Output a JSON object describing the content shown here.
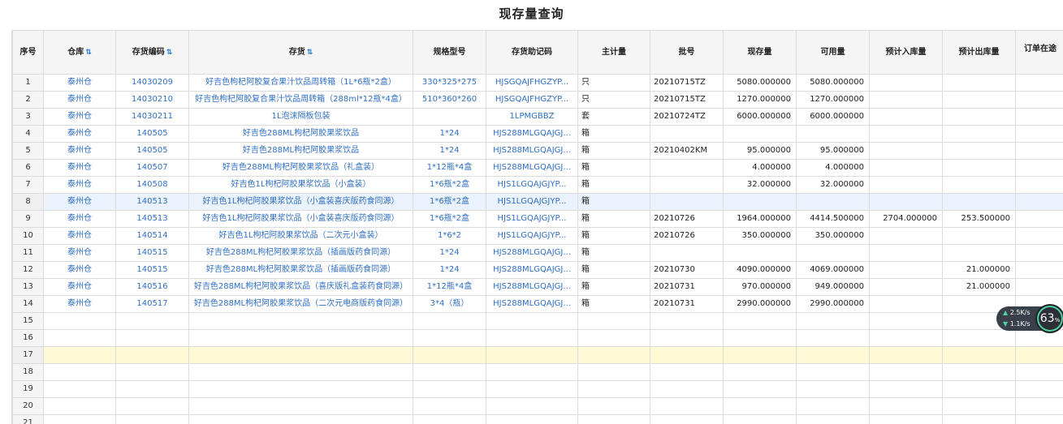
{
  "title": "现存量查询",
  "columns": [
    {
      "label": "序号",
      "sort": false
    },
    {
      "label": "仓库",
      "sort": true
    },
    {
      "label": "存货编码",
      "sort": true
    },
    {
      "label": "存货",
      "sort": true
    },
    {
      "label": "规格型号",
      "sort": false
    },
    {
      "label": "存货助记码",
      "sort": false
    },
    {
      "label": "主计量",
      "sort": false
    },
    {
      "label": "批号",
      "sort": false
    },
    {
      "label": "现存量",
      "sort": false
    },
    {
      "label": "可用量",
      "sort": false
    },
    {
      "label": "预计入库量",
      "sort": false
    },
    {
      "label": "预计出库量",
      "sort": false
    },
    {
      "label": "订单在途",
      "sort": false
    }
  ],
  "rows": [
    {
      "seq": "1",
      "warehouse": "泰州仓",
      "code": "14030209",
      "item": "好吉色枸杞阿胶复合果汁饮品周转箱（1L*6瓶*2盒）",
      "spec": "330*325*275",
      "mnemonic": "HJSGQAJFHGZYP...",
      "uom": "只",
      "batch": "20210715TZ",
      "onhand": "5080.000000",
      "available": "5080.000000",
      "exp_in": "",
      "exp_out": "",
      "onorder": ""
    },
    {
      "seq": "2",
      "warehouse": "泰州仓",
      "code": "14030210",
      "item": "好吉色枸杞阿胶复合果汁饮品周转箱（288ml*12瓶*4盒）",
      "spec": "510*360*260",
      "mnemonic": "HJSGQAJFHGZYP...",
      "uom": "只",
      "batch": "20210715TZ",
      "onhand": "1270.000000",
      "available": "1270.000000",
      "exp_in": "",
      "exp_out": "",
      "onorder": ""
    },
    {
      "seq": "3",
      "warehouse": "泰州仓",
      "code": "14030211",
      "item": "1L泡沫隔板包装",
      "spec": "",
      "mnemonic": "1LPMGBBZ",
      "uom": "套",
      "batch": "20210724TZ",
      "onhand": "6000.000000",
      "available": "6000.000000",
      "exp_in": "",
      "exp_out": "",
      "onorder": ""
    },
    {
      "seq": "4",
      "warehouse": "泰州仓",
      "code": "140505",
      "item": "好吉色288ML枸杞阿胶果浆饮品",
      "spec": "1*24",
      "mnemonic": "HJS288MLGQAJGJ...",
      "uom": "箱",
      "batch": "",
      "onhand": "",
      "available": "",
      "exp_in": "",
      "exp_out": "",
      "onorder": ""
    },
    {
      "seq": "5",
      "warehouse": "泰州仓",
      "code": "140505",
      "item": "好吉色288ML枸杞阿胶果浆饮品",
      "spec": "1*24",
      "mnemonic": "HJS288MLGQAJGJ...",
      "uom": "箱",
      "batch": "20210402KM",
      "onhand": "95.000000",
      "available": "95.000000",
      "exp_in": "",
      "exp_out": "",
      "onorder": ""
    },
    {
      "seq": "6",
      "warehouse": "泰州仓",
      "code": "140507",
      "item": "好吉色288ML枸杞阿胶果浆饮品（礼盒装）",
      "spec": "1*12瓶*4盒",
      "mnemonic": "HJS288MLGQAJGJ...",
      "uom": "箱",
      "batch": "",
      "onhand": "4.000000",
      "available": "4.000000",
      "exp_in": "",
      "exp_out": "",
      "onorder": ""
    },
    {
      "seq": "7",
      "warehouse": "泰州仓",
      "code": "140508",
      "item": "好吉色1L枸杞阿胶果浆饮品（小盒装）",
      "spec": "1*6瓶*2盒",
      "mnemonic": "HJS1LGQAJGJYP...",
      "uom": "箱",
      "batch": "",
      "onhand": "32.000000",
      "available": "32.000000",
      "exp_in": "",
      "exp_out": "",
      "onorder": ""
    },
    {
      "seq": "8",
      "warehouse": "泰州仓",
      "code": "140513",
      "item": "好吉色1L枸杞阿胶果浆饮品（小盒装喜庆版药食同源）",
      "spec": "1*6瓶*2盒",
      "mnemonic": "HJS1LGQAJGJYP...",
      "uom": "箱",
      "batch": "",
      "onhand": "",
      "available": "",
      "exp_in": "",
      "exp_out": "",
      "onorder": ""
    },
    {
      "seq": "9",
      "warehouse": "泰州仓",
      "code": "140513",
      "item": "好吉色1L枸杞阿胶果浆饮品（小盒装喜庆版药食同源）",
      "spec": "1*6瓶*2盒",
      "mnemonic": "HJS1LGQAJGJYP...",
      "uom": "箱",
      "batch": "20210726",
      "onhand": "1964.000000",
      "available": "4414.500000",
      "exp_in": "2704.000000",
      "exp_out": "253.500000",
      "onorder": ""
    },
    {
      "seq": "10",
      "warehouse": "泰州仓",
      "code": "140514",
      "item": "好吉色1L枸杞阿胶果浆饮品（二次元小盒装）",
      "spec": "1*6*2",
      "mnemonic": "HJS1LGQAJGJYP...",
      "uom": "箱",
      "batch": "20210726",
      "onhand": "350.000000",
      "available": "350.000000",
      "exp_in": "",
      "exp_out": "",
      "onorder": ""
    },
    {
      "seq": "11",
      "warehouse": "泰州仓",
      "code": "140515",
      "item": "好吉色288ML枸杞阿胶果浆饮品（插画版药食同源）",
      "spec": "1*24",
      "mnemonic": "HJS288MLGQAJGJ...",
      "uom": "箱",
      "batch": "",
      "onhand": "",
      "available": "",
      "exp_in": "",
      "exp_out": "",
      "onorder": ""
    },
    {
      "seq": "12",
      "warehouse": "泰州仓",
      "code": "140515",
      "item": "好吉色288ML枸杞阿胶果浆饮品（插画版药食同源）",
      "spec": "1*24",
      "mnemonic": "HJS288MLGQAJGJ...",
      "uom": "箱",
      "batch": "20210730",
      "onhand": "4090.000000",
      "available": "4069.000000",
      "exp_in": "",
      "exp_out": "21.000000",
      "onorder": ""
    },
    {
      "seq": "13",
      "warehouse": "泰州仓",
      "code": "140516",
      "item": "好吉色288ML枸杞阿胶果浆饮品（喜庆版礼盒装药食同源）",
      "spec": "1*12瓶*4盒",
      "mnemonic": "HJS288MLGQAJGJ...",
      "uom": "箱",
      "batch": "20210731",
      "onhand": "970.000000",
      "available": "949.000000",
      "exp_in": "",
      "exp_out": "21.000000",
      "onorder": ""
    },
    {
      "seq": "14",
      "warehouse": "泰州仓",
      "code": "140517",
      "item": "好吉色288ML枸杞阿胶果浆饮品（二次元电商版药食同源）",
      "spec": "3*4（瓶）",
      "mnemonic": "HJS288MLGQAJGJ...",
      "uom": "箱",
      "batch": "20210731",
      "onhand": "2990.000000",
      "available": "2990.000000",
      "exp_in": "",
      "exp_out": "",
      "onorder": ""
    },
    {
      "seq": "15",
      "warehouse": "",
      "code": "",
      "item": "",
      "spec": "",
      "mnemonic": "",
      "uom": "",
      "batch": "",
      "onhand": "",
      "available": "",
      "exp_in": "",
      "exp_out": "",
      "onorder": ""
    },
    {
      "seq": "16",
      "warehouse": "",
      "code": "",
      "item": "",
      "spec": "",
      "mnemonic": "",
      "uom": "",
      "batch": "",
      "onhand": "",
      "available": "",
      "exp_in": "",
      "exp_out": "",
      "onorder": ""
    },
    {
      "seq": "17",
      "warehouse": "",
      "code": "",
      "item": "",
      "spec": "",
      "mnemonic": "",
      "uom": "",
      "batch": "",
      "onhand": "",
      "available": "",
      "exp_in": "",
      "exp_out": "",
      "onorder": ""
    },
    {
      "seq": "18",
      "warehouse": "",
      "code": "",
      "item": "",
      "spec": "",
      "mnemonic": "",
      "uom": "",
      "batch": "",
      "onhand": "",
      "available": "",
      "exp_in": "",
      "exp_out": "",
      "onorder": ""
    },
    {
      "seq": "19",
      "warehouse": "",
      "code": "",
      "item": "",
      "spec": "",
      "mnemonic": "",
      "uom": "",
      "batch": "",
      "onhand": "",
      "available": "",
      "exp_in": "",
      "exp_out": "",
      "onorder": ""
    },
    {
      "seq": "20",
      "warehouse": "",
      "code": "",
      "item": "",
      "spec": "",
      "mnemonic": "",
      "uom": "",
      "batch": "",
      "onhand": "",
      "available": "",
      "exp_in": "",
      "exp_out": "",
      "onorder": ""
    },
    {
      "seq": "21",
      "warehouse": "",
      "code": "",
      "item": "",
      "spec": "",
      "mnemonic": "",
      "uom": "",
      "batch": "",
      "onhand": "",
      "available": "",
      "exp_in": "",
      "exp_out": "",
      "onorder": ""
    }
  ],
  "selected_row": "8",
  "highlighted_row": "17",
  "network_widget": {
    "upload": "2.5",
    "upload_unit": "K/s",
    "download": "1.1",
    "download_unit": "K/s",
    "percent": "63",
    "percent_unit": "%"
  },
  "colors": {
    "link": "#2f6fc4",
    "sort_icon": "#1f7bd6",
    "header_bg": "#f5f5f5",
    "selected_row_bg": "#e9f2fd",
    "highlight_row_bg": "#fff9d6"
  },
  "icons": {
    "sort": "sort-arrows-icon",
    "upload": "arrow-up-icon",
    "download": "arrow-down-icon"
  }
}
